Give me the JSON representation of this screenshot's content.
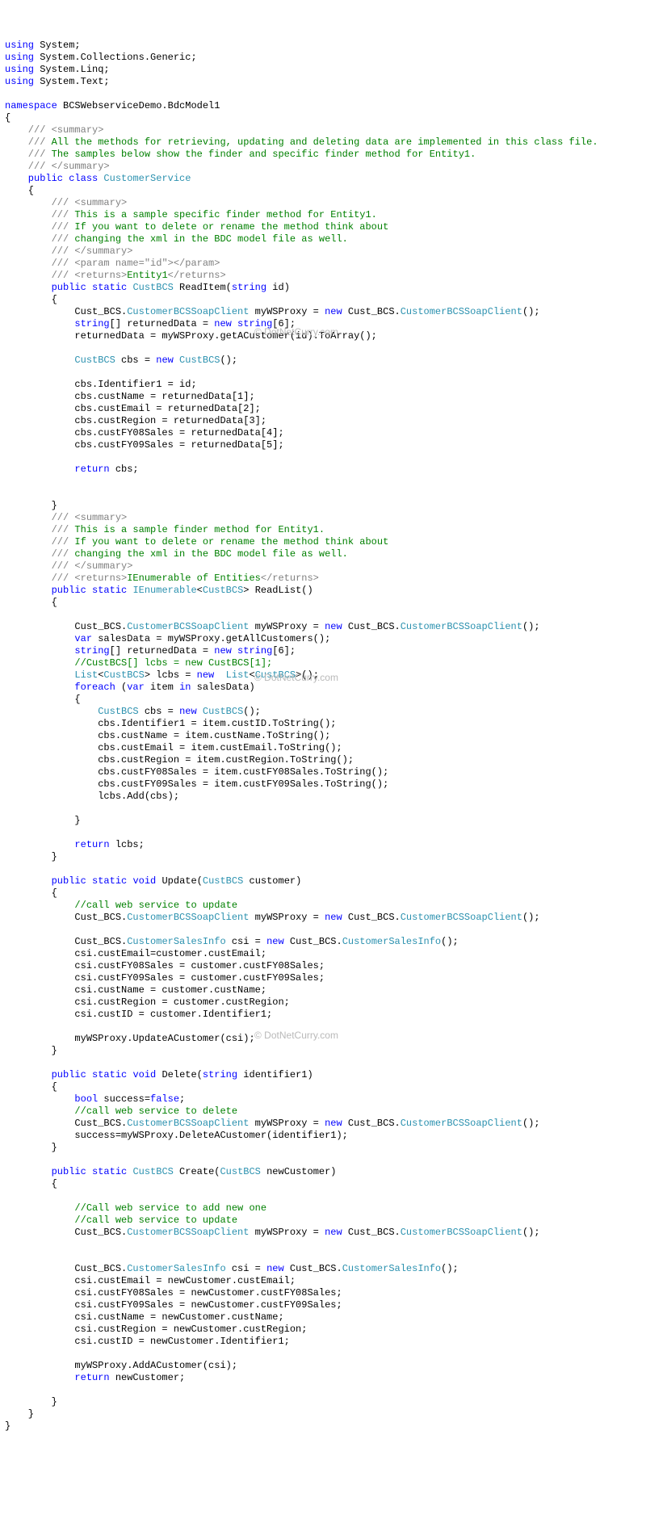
{
  "watermark": "© DotNetCurry.com",
  "code": {
    "L1": {
      "kw1": "using",
      "t1": " System;"
    },
    "L2": {
      "kw1": "using",
      "t1": " System.Collections.Generic;"
    },
    "L3": {
      "kw1": "using",
      "t1": " System.Linq;"
    },
    "L4": {
      "kw1": "using",
      "t1": " System.Text;"
    },
    "L6": {
      "kw1": "namespace",
      "t1": " BCSWebserviceDemo.BdcModel1"
    },
    "L7": "{",
    "L8": {
      "g1": "    /// ",
      "g2": "<summary>"
    },
    "L9": {
      "g1": "    ///",
      "c1": " All the methods for retrieving, updating and deleting data are implemented in this class file."
    },
    "L10": {
      "g1": "    ///",
      "c1": " The samples below show the finder and specific finder method for Entity1."
    },
    "L11": {
      "g1": "    /// ",
      "g2": "</summary>"
    },
    "L12": {
      "kw1": "    public",
      "kw2": " class",
      "ty1": " CustomerService"
    },
    "L13": "    {",
    "L14": {
      "g1": "        /// ",
      "g2": "<summary>"
    },
    "L15": {
      "g1": "        ///",
      "c1": " This is a sample specific finder method for Entity1."
    },
    "L16": {
      "g1": "        ///",
      "c1": " If you want to delete or rename the method think about"
    },
    "L17": {
      "g1": "        ///",
      "c1": " changing the xml in the BDC model file as well."
    },
    "L18": {
      "g1": "        /// ",
      "g2": "</summary>"
    },
    "L19": {
      "g1": "        /// ",
      "g2": "<param name=\"id\"></param>"
    },
    "L20": {
      "g1": "        /// ",
      "g2": "<returns>",
      "t1": "Entity1",
      "g3": "</returns>"
    },
    "L21": {
      "kw1": "        public",
      "kw2": " static",
      "ty1": " CustBCS",
      "t1": " ReadItem(",
      "kw3": "string",
      "t2": " id)"
    },
    "L22": "        {",
    "L23": {
      "t1": "            Cust_BCS.",
      "ty1": "CustomerBCSSoapClient",
      "t2": " myWSProxy = ",
      "kw1": "new",
      "t3": " Cust_BCS.",
      "ty2": "CustomerBCSSoapClient",
      "t4": "();"
    },
    "L24": {
      "kw1": "            string",
      "t1": "[] returnedData = ",
      "kw2": "new",
      "kw3": " string",
      "t2": "[6];"
    },
    "L25": "            returnedData = myWSProxy.getACustomer(id).ToArray();",
    "L27": {
      "ty1": "            CustBCS",
      "t1": " cbs = ",
      "kw1": "new",
      "ty2": " CustBCS",
      "t2": "();"
    },
    "L29": "            cbs.Identifier1 = id;",
    "L30": "            cbs.custName = returnedData[1];",
    "L31": "            cbs.custEmail = returnedData[2];",
    "L32": "            cbs.custRegion = returnedData[3];",
    "L33": "            cbs.custFY08Sales = returnedData[4];",
    "L34": "            cbs.custFY09Sales = returnedData[5];",
    "L36": {
      "kw1": "            return",
      "t1": " cbs;"
    },
    "L39": "        }",
    "L40": {
      "g1": "        /// ",
      "g2": "<summary>"
    },
    "L41": {
      "g1": "        ///",
      "c1": " This is a sample finder method for Entity1."
    },
    "L42": {
      "g1": "        ///",
      "c1": " If you want to delete or rename the method think about"
    },
    "L43": {
      "g1": "        ///",
      "c1": " changing the xml in the BDC model file as well."
    },
    "L44": {
      "g1": "        /// ",
      "g2": "</summary>"
    },
    "L45": {
      "g1": "        /// ",
      "g2": "<returns>",
      "t1": "IEnumerable of Entities",
      "g3": "</returns>"
    },
    "L46": {
      "kw1": "        public",
      "kw2": " static",
      "ty1": " IEnumerable",
      "t1": "<",
      "ty2": "CustBCS",
      "t2": "> ReadList()"
    },
    "L47": "        {",
    "L49": {
      "t1": "            Cust_BCS.",
      "ty1": "CustomerBCSSoapClient",
      "t2": " myWSProxy = ",
      "kw1": "new",
      "t3": " Cust_BCS.",
      "ty2": "CustomerBCSSoapClient",
      "t4": "();"
    },
    "L50": {
      "kw1": "            var",
      "t1": " salesData = myWSProxy.getAllCustomers();"
    },
    "L51": {
      "kw1": "            string",
      "t1": "[] returnedData = ",
      "kw2": "new",
      "kw3": " string",
      "t2": "[6];"
    },
    "L52": {
      "c1": "            //CustBCS[] lcbs = new CustBCS[1];"
    },
    "L53": {
      "ty1": "            List",
      "t1": "<",
      "ty2": "CustBCS",
      "t2": "> lcbs = ",
      "kw1": "new",
      "ty3": "  List",
      "t3": "<",
      "ty4": "CustBCS",
      "t4": ">();"
    },
    "L54": {
      "kw1": "            foreach",
      "t1": " (",
      "kw2": "var",
      "t2": " item ",
      "kw3": "in",
      "t3": " salesData)"
    },
    "L55": "            {",
    "L56": {
      "ty1": "                CustBCS",
      "t1": " cbs = ",
      "kw1": "new",
      "ty2": " CustBCS",
      "t2": "();"
    },
    "L57": "                cbs.Identifier1 = item.custID.ToString();",
    "L58": "                cbs.custName = item.custName.ToString();",
    "L59": "                cbs.custEmail = item.custEmail.ToString();",
    "L60": "                cbs.custRegion = item.custRegion.ToString();",
    "L61": "                cbs.custFY08Sales = item.custFY08Sales.ToString();",
    "L62": "                cbs.custFY09Sales = item.custFY09Sales.ToString();",
    "L63": "                lcbs.Add(cbs);",
    "L65": "            }",
    "L67": {
      "kw1": "            return",
      "t1": " lcbs;"
    },
    "L68": "        }",
    "L70": {
      "kw1": "        public",
      "kw2": " static",
      "kw3": " void",
      "t1": " Update(",
      "ty1": "CustBCS",
      "t2": " customer)"
    },
    "L71": "        {",
    "L72": {
      "c1": "            //call web service to update"
    },
    "L73": {
      "t1": "            Cust_BCS.",
      "ty1": "CustomerBCSSoapClient",
      "t2": " myWSProxy = ",
      "kw1": "new",
      "t3": " Cust_BCS.",
      "ty2": "CustomerBCSSoapClient",
      "t4": "();"
    },
    "L75": {
      "t1": "            Cust_BCS.",
      "ty1": "CustomerSalesInfo",
      "t2": " csi = ",
      "kw1": "new",
      "t3": " Cust_BCS.",
      "ty2": "CustomerSalesInfo",
      "t4": "();"
    },
    "L76": "            csi.custEmail=customer.custEmail;",
    "L77": "            csi.custFY08Sales = customer.custFY08Sales;",
    "L78": "            csi.custFY09Sales = customer.custFY09Sales;",
    "L79": "            csi.custName = customer.custName;",
    "L80": "            csi.custRegion = customer.custRegion;",
    "L81": "            csi.custID = customer.Identifier1;",
    "L83": "            myWSProxy.UpdateACustomer(csi);",
    "L84": "        }",
    "L86": {
      "kw1": "        public",
      "kw2": " static",
      "kw3": " void",
      "t1": " Delete(",
      "kw4": "string",
      "t2": " identifier1)"
    },
    "L87": "        {",
    "L88": {
      "kw1": "            bool",
      "t1": " success=",
      "kw2": "false",
      "t2": ";"
    },
    "L89": {
      "c1": "            //call web service to delete"
    },
    "L90": {
      "t1": "            Cust_BCS.",
      "ty1": "CustomerBCSSoapClient",
      "t2": " myWSProxy = ",
      "kw1": "new",
      "t3": " Cust_BCS.",
      "ty2": "CustomerBCSSoapClient",
      "t4": "();"
    },
    "L91": "            success=myWSProxy.DeleteACustomer(identifier1);",
    "L92": "        }",
    "L94": {
      "kw1": "        public",
      "kw2": " static",
      "ty1": " CustBCS",
      "t1": " Create(",
      "ty2": "CustBCS",
      "t2": " newCustomer)"
    },
    "L95": "        {",
    "L97": {
      "c1": "            //Call web service to add new one"
    },
    "L98": {
      "c1": "            //call web service to update"
    },
    "L99": {
      "t1": "            Cust_BCS.",
      "ty1": "CustomerBCSSoapClient",
      "t2": " myWSProxy = ",
      "kw1": "new",
      "t3": " Cust_BCS.",
      "ty2": "CustomerBCSSoapClient",
      "t4": "();"
    },
    "L102": {
      "t1": "            Cust_BCS.",
      "ty1": "CustomerSalesInfo",
      "t2": " csi = ",
      "kw1": "new",
      "t3": " Cust_BCS.",
      "ty2": "CustomerSalesInfo",
      "t4": "();"
    },
    "L103": "            csi.custEmail = newCustomer.custEmail;",
    "L104": "            csi.custFY08Sales = newCustomer.custFY08Sales;",
    "L105": "            csi.custFY09Sales = newCustomer.custFY09Sales;",
    "L106": "            csi.custName = newCustomer.custName;",
    "L107": "            csi.custRegion = newCustomer.custRegion;",
    "L108": "            csi.custID = newCustomer.Identifier1;",
    "L110": "            myWSProxy.AddACustomer(csi);",
    "L111": {
      "kw1": "            return",
      "t1": " newCustomer;"
    },
    "L113": "        }",
    "L114": "    }",
    "L115": "}"
  }
}
